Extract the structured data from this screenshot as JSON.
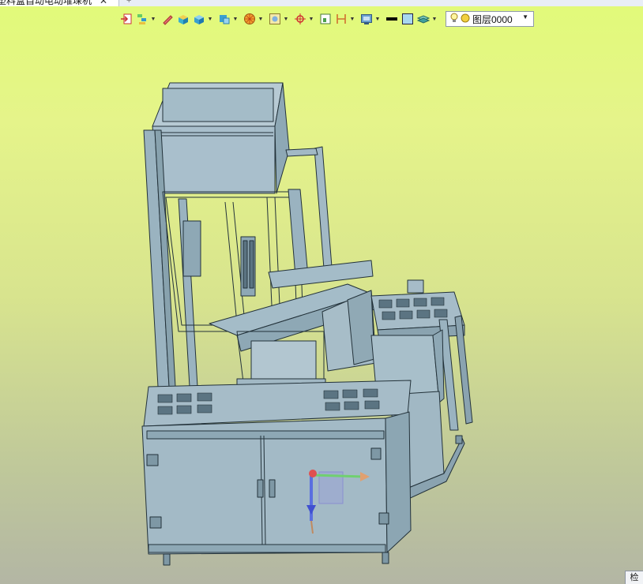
{
  "document_tab": {
    "title": "塑料盒自动电动堆垛机",
    "close_glyph": "✕",
    "new_tab_glyph": "+"
  },
  "toolbar": {
    "icons": [
      "exit-sketch-icon",
      "feature-tree-icon",
      "pencil-sketch-icon",
      "render-style-icon",
      "solid-view-icon",
      "section-view-icon",
      "color-wheel-icon",
      "orient-view-icon",
      "snap-point-icon",
      "zoom-fit-icon",
      "measure-icon",
      "display-settings-icon",
      "line-color-swatch",
      "fill-color-swatch",
      "layers-icon"
    ],
    "dropdown_glyph": "▼",
    "layer_selector": {
      "value": "图层0000"
    }
  },
  "viewport": {
    "background_top": "#e2fa7a",
    "background_bottom": "#b3b6a4",
    "model_color": "#9fb7c3",
    "edge_color": "#23323a"
  },
  "corner_widget": {
    "label": "检"
  }
}
